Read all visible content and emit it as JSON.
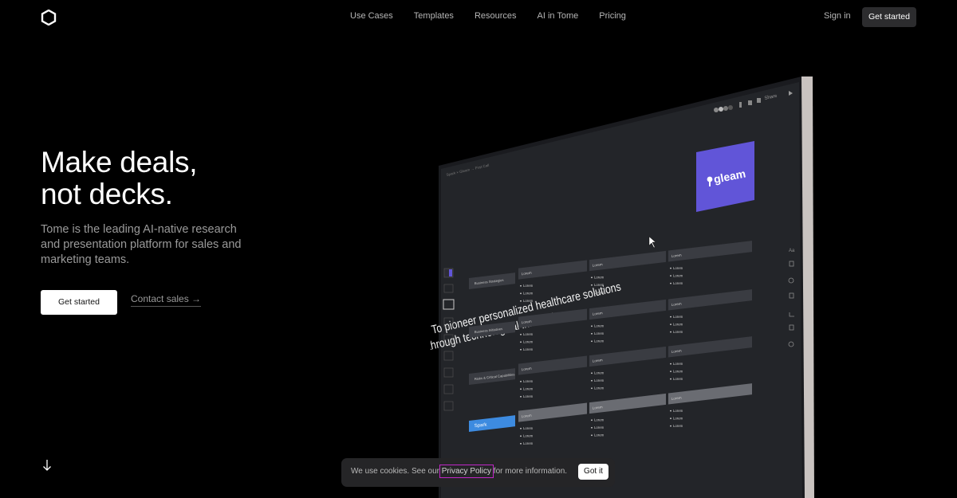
{
  "nav": {
    "links": [
      "Use Cases",
      "Templates",
      "Resources",
      "AI in Tome",
      "Pricing"
    ],
    "sign_in": "Sign in",
    "get_started": "Get started"
  },
  "hero": {
    "headline_line1": "Make deals,",
    "headline_line2": "not decks.",
    "subhead": "Tome is the leading AI-native research and presentation platform for sales and marketing teams.",
    "cta_primary": "Get started",
    "cta_secondary": "Contact sales →"
  },
  "mockup": {
    "share_label": "Share",
    "breadcrumb": "Spark × Gleam → First Call",
    "slide_title_line1": "To pioneer personalized healthcare solutions",
    "slide_title_line2": "through technological innovation.",
    "brand_logo": "gleam",
    "brand_color": "#6155d8",
    "rows": [
      {
        "label": "Business Strategies",
        "cells": [
          "Lorem",
          "Lorem",
          "Lorem"
        ]
      },
      {
        "label": "Business Initiatives",
        "cells": [
          "Lorem",
          "Lorem",
          "Lorem"
        ]
      },
      {
        "label": "Risks & Critical Capabilities",
        "cells": [
          "Lorem",
          "Lorem",
          "Lorem"
        ]
      },
      {
        "label": "Spark",
        "cells": [
          "Lorem",
          "Lorem",
          "Lorem"
        ]
      }
    ],
    "bullet_text": "Lorem",
    "spark_color": "#3d8be0"
  },
  "cookie": {
    "prefix": "We use cookies. See our ",
    "link": "Privacy Policy",
    "suffix": " for more information.",
    "button": "Got it"
  }
}
